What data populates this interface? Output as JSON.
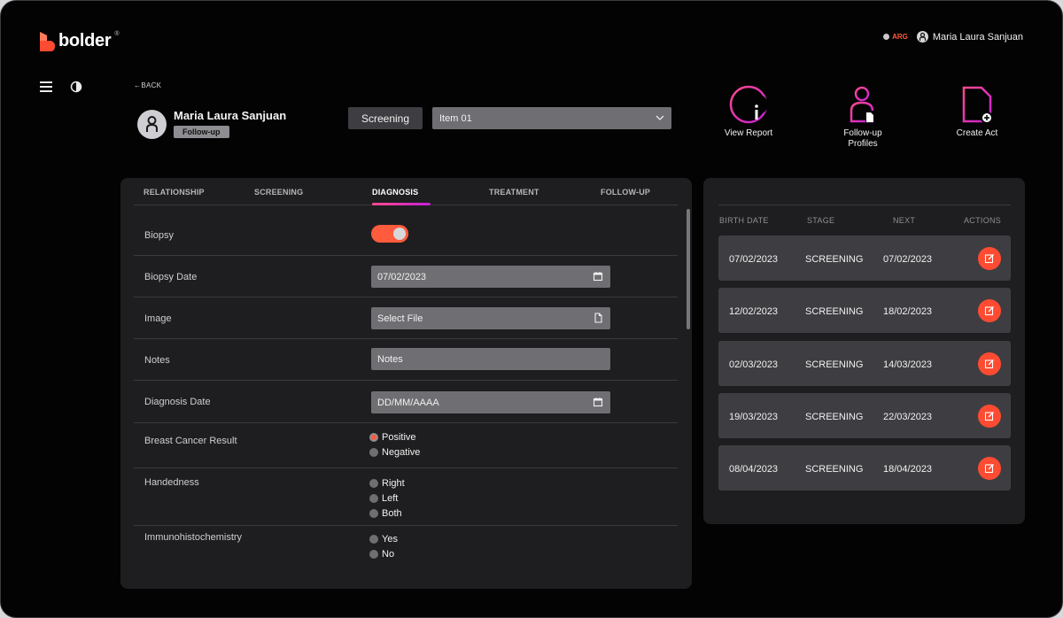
{
  "header": {
    "logo_text": "bolder",
    "logo_tm": "®",
    "region": "ARG",
    "user_name": "Maria Laura Sanjuan"
  },
  "icons": {
    "menu": "hamburger-menu-icon",
    "theme": "contrast-icon",
    "user": "user-icon"
  },
  "nav": {
    "back_label": "BACK"
  },
  "patient": {
    "name": "Maria Laura Sanjuan",
    "badge": "Follow-up",
    "stage_button": "Screening",
    "item_select": "Item 01"
  },
  "actions": [
    {
      "label": "View Report",
      "icon": "info-circle-icon"
    },
    {
      "label": "Follow-up Profiles",
      "icon": "user-document-icon"
    },
    {
      "label": "Create Act",
      "icon": "add-document-icon"
    }
  ],
  "tabs": [
    {
      "label": "RELATIONSHIP"
    },
    {
      "label": "SCREENING"
    },
    {
      "label": "DIAGNOSIS"
    },
    {
      "label": "TREATMENT"
    },
    {
      "label": "FOLLOW-UP"
    }
  ],
  "active_tab": "DIAGNOSIS",
  "form": {
    "biopsy_label": "Biopsy",
    "biopsy_on": true,
    "biopsy_date_label": "Biopsy Date",
    "biopsy_date_value": "07/02/2023",
    "image_label": "Image",
    "image_value": "Select File",
    "notes_label": "Notes",
    "notes_placeholder": "Notes",
    "diagnosis_date_label": "Diagnosis Date",
    "diagnosis_date_placeholder": "DD/MM/AAAA",
    "bcr_label": "Breast Cancer Result",
    "bcr_options": [
      "Positive",
      "Negative"
    ],
    "bcr_selected": "Positive",
    "handedness_label": "Handedness",
    "handedness_options": [
      "Right",
      "Left",
      "Both"
    ],
    "ihc_label": "Immunohistochemistry",
    "ihc_options": [
      "Yes",
      "No"
    ]
  },
  "history_table": {
    "headers": [
      "BIRTH DATE",
      "STAGE",
      "NEXT",
      "ACTIONS"
    ],
    "rows": [
      {
        "birth_date": "07/02/2023",
        "stage": "SCREENING",
        "next": "07/02/2023"
      },
      {
        "birth_date": "12/02/2023",
        "stage": "SCREENING",
        "next": "18/02/2023"
      },
      {
        "birth_date": "02/03/2023",
        "stage": "SCREENING",
        "next": "14/03/2023"
      },
      {
        "birth_date": "19/03/2023",
        "stage": "SCREENING",
        "next": "22/03/2023"
      },
      {
        "birth_date": "08/04/2023",
        "stage": "SCREENING",
        "next": "18/04/2023"
      }
    ]
  },
  "colors": {
    "accent": "#ff5b3d",
    "gradient_start": "#ff4a8d",
    "gradient_end": "#c51fd8",
    "panel": "#1e1e20",
    "background": "#030303"
  }
}
